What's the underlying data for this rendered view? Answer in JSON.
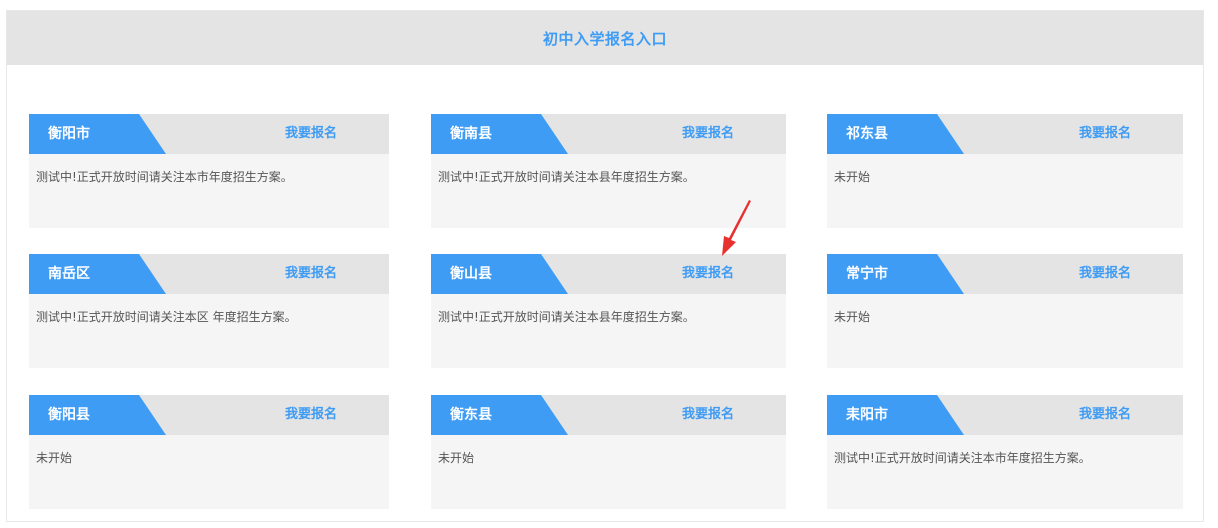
{
  "page": {
    "title": "初中入学报名入口"
  },
  "cards": [
    {
      "name": "衡阳市",
      "link": "我要报名",
      "status": "测试中!正式开放时间请关注本市年度招生方案。"
    },
    {
      "name": "衡南县",
      "link": "我要报名",
      "status": "测试中!正式开放时间请关注本县年度招生方案。"
    },
    {
      "name": "祁东县",
      "link": "我要报名",
      "status": "未开始"
    },
    {
      "name": "南岳区",
      "link": "我要报名",
      "status": "测试中!正式开放时间请关注本区 年度招生方案。"
    },
    {
      "name": "衡山县",
      "link": "我要报名",
      "status": "测试中!正式开放时间请关注本县年度招生方案。"
    },
    {
      "name": "常宁市",
      "link": "我要报名",
      "status": "未开始"
    },
    {
      "name": "衡阳县",
      "link": "我要报名",
      "status": "未开始"
    },
    {
      "name": "衡东县",
      "link": "我要报名",
      "status": "未开始"
    },
    {
      "name": "耒阳市",
      "link": "我要报名",
      "status": "测试中!正式开放时间请关注本市年度招生方案。"
    }
  ],
  "colors": {
    "accent": "#3f9cf5",
    "header_bg": "#e4e4e4",
    "card_bg": "#f5f5f5",
    "arrow": "#e8312f"
  },
  "annotation": {
    "icon": "red-pointer-arrow-icon"
  }
}
